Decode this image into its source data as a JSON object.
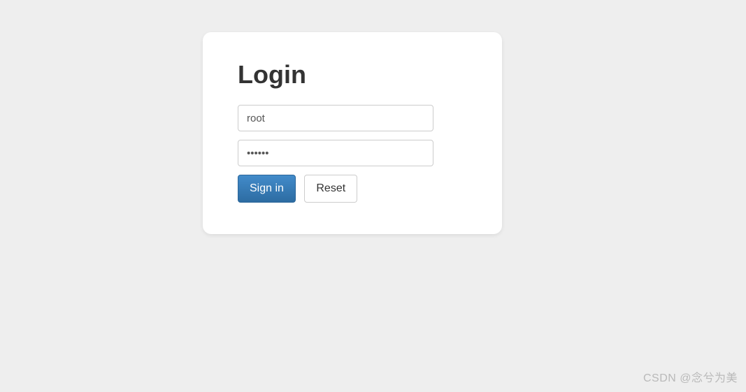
{
  "login": {
    "title": "Login",
    "username_value": "root",
    "password_value": "••••••",
    "signin_label": "Sign in",
    "reset_label": "Reset"
  },
  "watermark": "CSDN @念兮为美"
}
